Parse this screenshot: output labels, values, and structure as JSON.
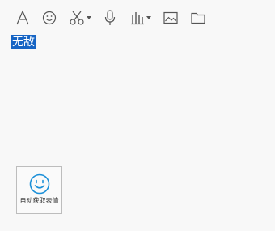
{
  "toolbar": {
    "items": [
      {
        "name": "font",
        "icon": "font-icon"
      },
      {
        "name": "emoji",
        "icon": "smiley-icon"
      },
      {
        "name": "screenshot",
        "icon": "scissors-icon",
        "has_dropdown": true
      },
      {
        "name": "voice",
        "icon": "microphone-icon"
      },
      {
        "name": "music",
        "icon": "audio-bars-icon",
        "has_dropdown": true
      },
      {
        "name": "image",
        "icon": "image-icon"
      },
      {
        "name": "file",
        "icon": "folder-icon"
      }
    ]
  },
  "editor": {
    "text": "无敌",
    "selection_color": "#1664c4"
  },
  "emoji_suggest": {
    "label": "自动获取表情",
    "icon": "smiley-icon",
    "icon_color": "#1a8fd8"
  }
}
